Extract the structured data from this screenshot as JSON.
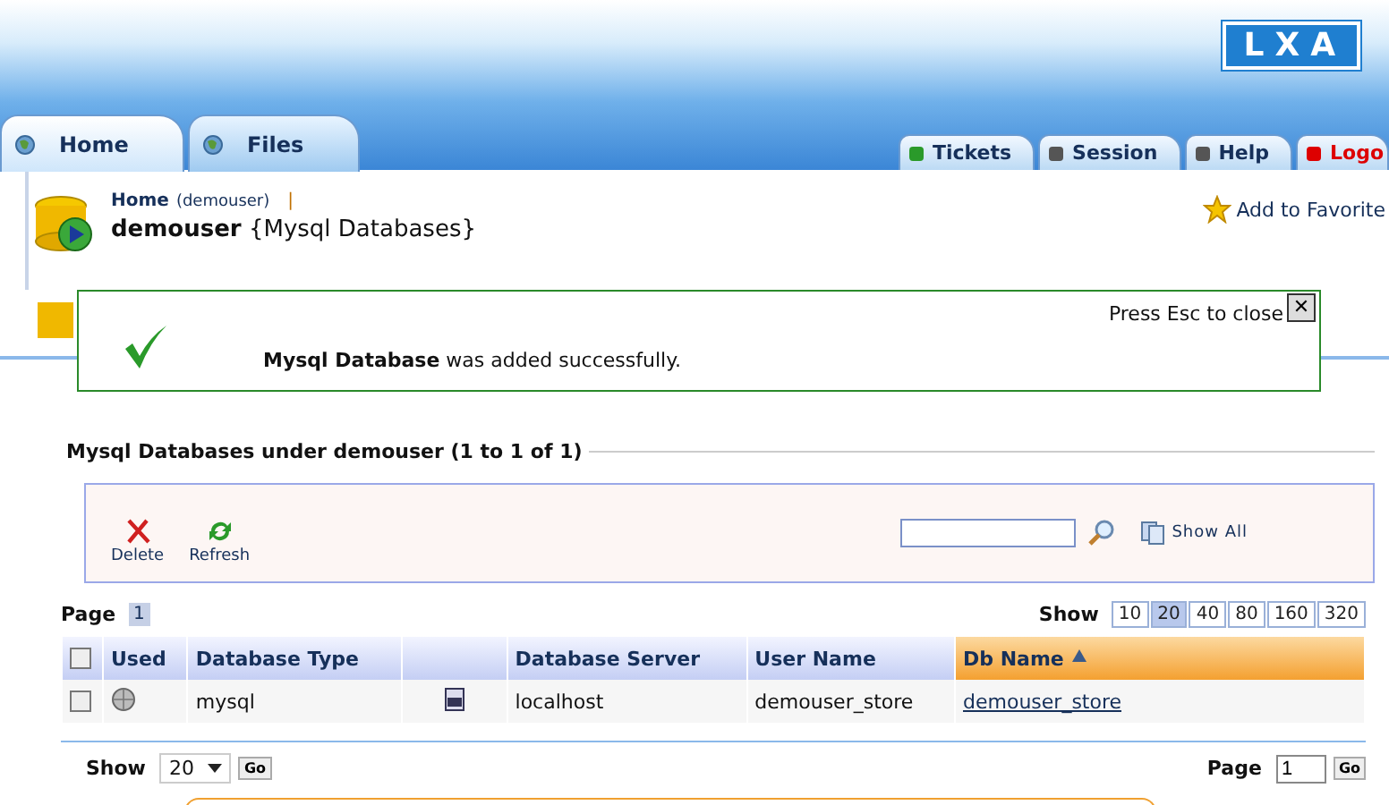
{
  "logo": "LXA",
  "main_tabs": [
    {
      "label": "Home",
      "selected": true
    },
    {
      "label": "Files",
      "selected": false
    }
  ],
  "right_tabs": [
    {
      "label": "Tickets",
      "kind": "tickets"
    },
    {
      "label": "Session",
      "kind": "session"
    },
    {
      "label": "Help",
      "kind": "help"
    },
    {
      "label": "Logo",
      "kind": "logout"
    }
  ],
  "breadcrumb": {
    "link": "Home",
    "user": "(demouser)",
    "separator": "|"
  },
  "page_title": {
    "user": "demouser",
    "section": "{Mysql Databases}"
  },
  "favorites": "Add to Favorite",
  "message": {
    "close_hint": "Press Esc to close",
    "close": "✕",
    "text": "**Mysql Database** was added successfully."
  },
  "section_title": "Mysql Databases under demouser (1 to 1 of 1)",
  "toolbar": {
    "actions": [
      {
        "label": "Delete",
        "kind": "delete"
      },
      {
        "label": "Refresh",
        "kind": "refresh"
      }
    ],
    "show_all": "Show All"
  },
  "pager": {
    "label": "Page",
    "pages": [
      {
        "label": "1",
        "selected": true
      }
    ],
    "show_label": "Show",
    "sizes": [
      {
        "label": "10",
        "selected": false
      },
      {
        "label": "20",
        "selected": true
      },
      {
        "label": "40",
        "selected": false
      },
      {
        "label": "80",
        "selected": false
      },
      {
        "label": "160",
        "selected": false
      },
      {
        "label": "320",
        "selected": false
      }
    ]
  },
  "table": {
    "columns": [
      {
        "kind": "check",
        "checked": false
      },
      {
        "label": "Used",
        "kind": "text"
      },
      {
        "label": "Database Type",
        "kind": "text"
      },
      {
        "kind": "icon"
      },
      {
        "label": "Database Server",
        "kind": "text"
      },
      {
        "label": "User Name",
        "kind": "text"
      },
      {
        "label": "Db Name",
        "kind": "sorted"
      }
    ],
    "rows": [
      {
        "checked": false,
        "type": "mysql",
        "server": "localhost",
        "user": "demouser_store",
        "db": "demouser_store"
      }
    ]
  },
  "footer": {
    "show_label": "Show",
    "show_value": "20",
    "go": "Go",
    "page_label": "Page",
    "page_value": "1",
    "page_go": "Go"
  }
}
